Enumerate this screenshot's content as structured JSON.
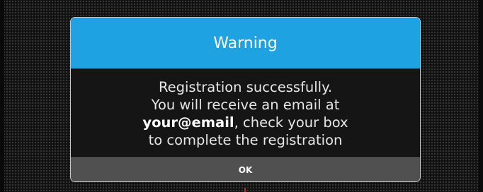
{
  "dialog": {
    "title": "Warning",
    "message": {
      "line1": "Registration successfully.",
      "line2": "You will receive an email at",
      "email": "your@email",
      "line3_suffix": ", check your box",
      "line4": "to complete the registration"
    },
    "ok_label": "OK"
  },
  "colors": {
    "header": "#1fa2e2",
    "body": "#151515",
    "footer": "#505050",
    "background": "#111111"
  }
}
